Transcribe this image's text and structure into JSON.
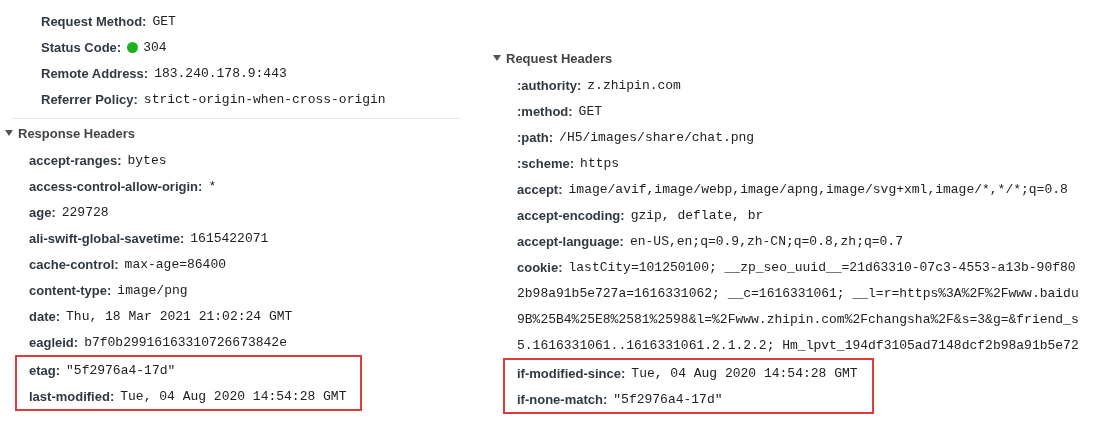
{
  "general": [
    {
      "name": "Request Method:",
      "value": "GET"
    },
    {
      "name": "Status Code:",
      "value": "304",
      "color": "#1db31d"
    },
    {
      "name": "Remote Address:",
      "value": "183.240.178.9:443"
    },
    {
      "name": "Referrer Policy:",
      "value": "strict-origin-when-cross-origin"
    }
  ],
  "response_headers": {
    "title": "Response Headers",
    "expanded": true,
    "rows": [
      {
        "name": "accept-ranges:",
        "value": "bytes",
        "highlighted": false
      },
      {
        "name": "access-control-allow-origin:",
        "value": "*",
        "highlighted": false
      },
      {
        "name": "age:",
        "value": "229728",
        "highlighted": false
      },
      {
        "name": "ali-swift-global-savetime:",
        "value": "1615422071",
        "highlighted": false
      },
      {
        "name": "cache-control:",
        "value": "max-age=86400",
        "highlighted": false
      },
      {
        "name": "content-type:",
        "value": "image/png",
        "highlighted": false
      },
      {
        "name": "date:",
        "value": "Thu, 18 Mar 2021 21:02:24 GMT",
        "highlighted": false
      },
      {
        "name": "eagleid:",
        "value": "b7f0b29916163310726673842e",
        "highlighted": false
      },
      {
        "name": "etag:",
        "value": "\"5f2976a4-17d\"",
        "highlighted": true
      },
      {
        "name": "last-modified:",
        "value": "Tue, 04 Aug 2020 14:54:28 GMT",
        "highlighted": true
      }
    ]
  },
  "request_headers": {
    "title": "Request Headers",
    "expanded": true,
    "rows": [
      {
        "name": ":authority:",
        "value": "z.zhipin.com",
        "highlighted": false
      },
      {
        "name": ":method:",
        "value": "GET",
        "highlighted": false
      },
      {
        "name": ":path:",
        "value": "/H5/images/share/chat.png",
        "highlighted": false
      },
      {
        "name": ":scheme:",
        "value": "https",
        "highlighted": false
      },
      {
        "name": "accept:",
        "value": "image/avif,image/webp,image/apng,image/svg+xml,image/*,*/*;q=0.8",
        "highlighted": false
      },
      {
        "name": "accept-encoding:",
        "value": "gzip, deflate, br",
        "highlighted": false
      },
      {
        "name": "accept-language:",
        "value": "en-US,en;q=0.9,zh-CN;q=0.8,zh;q=0.7",
        "highlighted": false
      },
      {
        "name": "cookie:",
        "value": "lastCity=101250100; __zp_seo_uuid__=21d63310-07c3-4553-a13b-90f80",
        "continuation_lines": [
          "2b98a91b5e727a=1616331062; __c=1616331061; __l=r=https%3A%2F%2Fwww.baidu",
          "9B%25B4%25E8%2581%2598&l=%2Fwww.zhipin.com%2Fchangsha%2F&s=3&g=&friend_s",
          "5.1616331061..1616331061.2.1.2.2; Hm_lpvt_194df3105ad7148dcf2b98a91b5e72"
        ],
        "highlighted": false
      },
      {
        "name": "if-modified-since:",
        "value": "Tue, 04 Aug 2020 14:54:28 GMT",
        "highlighted": true
      },
      {
        "name": "if-none-match:",
        "value": "\"5f2976a4-17d\"",
        "highlighted": true
      }
    ]
  }
}
